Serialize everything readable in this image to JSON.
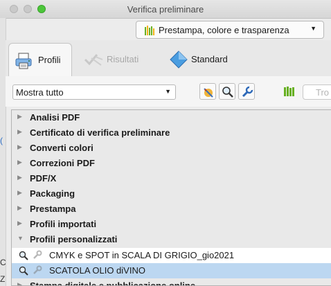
{
  "window": {
    "title": "Verifica preliminare"
  },
  "preset": {
    "label": "Prestampa, colore e trasparenza"
  },
  "tabs": [
    {
      "label": "Profili",
      "icon": "printer-icon",
      "active": true,
      "enabled": true
    },
    {
      "label": "Risultati",
      "icon": "results-icon",
      "active": false,
      "enabled": false
    },
    {
      "label": "Standard",
      "icon": "standard-icon",
      "active": false,
      "enabled": true
    }
  ],
  "toolbar": {
    "filter_value": "Mostra tutto",
    "search_placeholder": "Tro",
    "icons": [
      "wizard-icon",
      "magnifier-icon",
      "wrench-icon",
      "library-icon"
    ]
  },
  "categories": [
    {
      "label": "Analisi PDF",
      "expanded": false
    },
    {
      "label": "Certificato di verifica preliminare",
      "expanded": false
    },
    {
      "label": "Converti colori",
      "expanded": false
    },
    {
      "label": "Correzioni PDF",
      "expanded": false
    },
    {
      "label": "PDF/X",
      "expanded": false
    },
    {
      "label": "Packaging",
      "expanded": false
    },
    {
      "label": "Prestampa",
      "expanded": false
    },
    {
      "label": "Profili importati",
      "expanded": false
    },
    {
      "label": "Profili personalizzati",
      "expanded": true
    }
  ],
  "custom_profiles": [
    {
      "label": "CMYK e SPOT in SCALA DI GRIGIO_gio2021",
      "selected": false
    },
    {
      "label": "SCATOLA OLIO diVINO",
      "selected": true
    }
  ],
  "next_category": {
    "label": "Stampa digitale e pubblicazione online"
  },
  "edge_glyphs": [
    "(",
    "C",
    "Z"
  ],
  "colors": {
    "selection": "#bcd7f1",
    "accent_green": "#67b021",
    "link_blue": "#2b6cc4"
  }
}
